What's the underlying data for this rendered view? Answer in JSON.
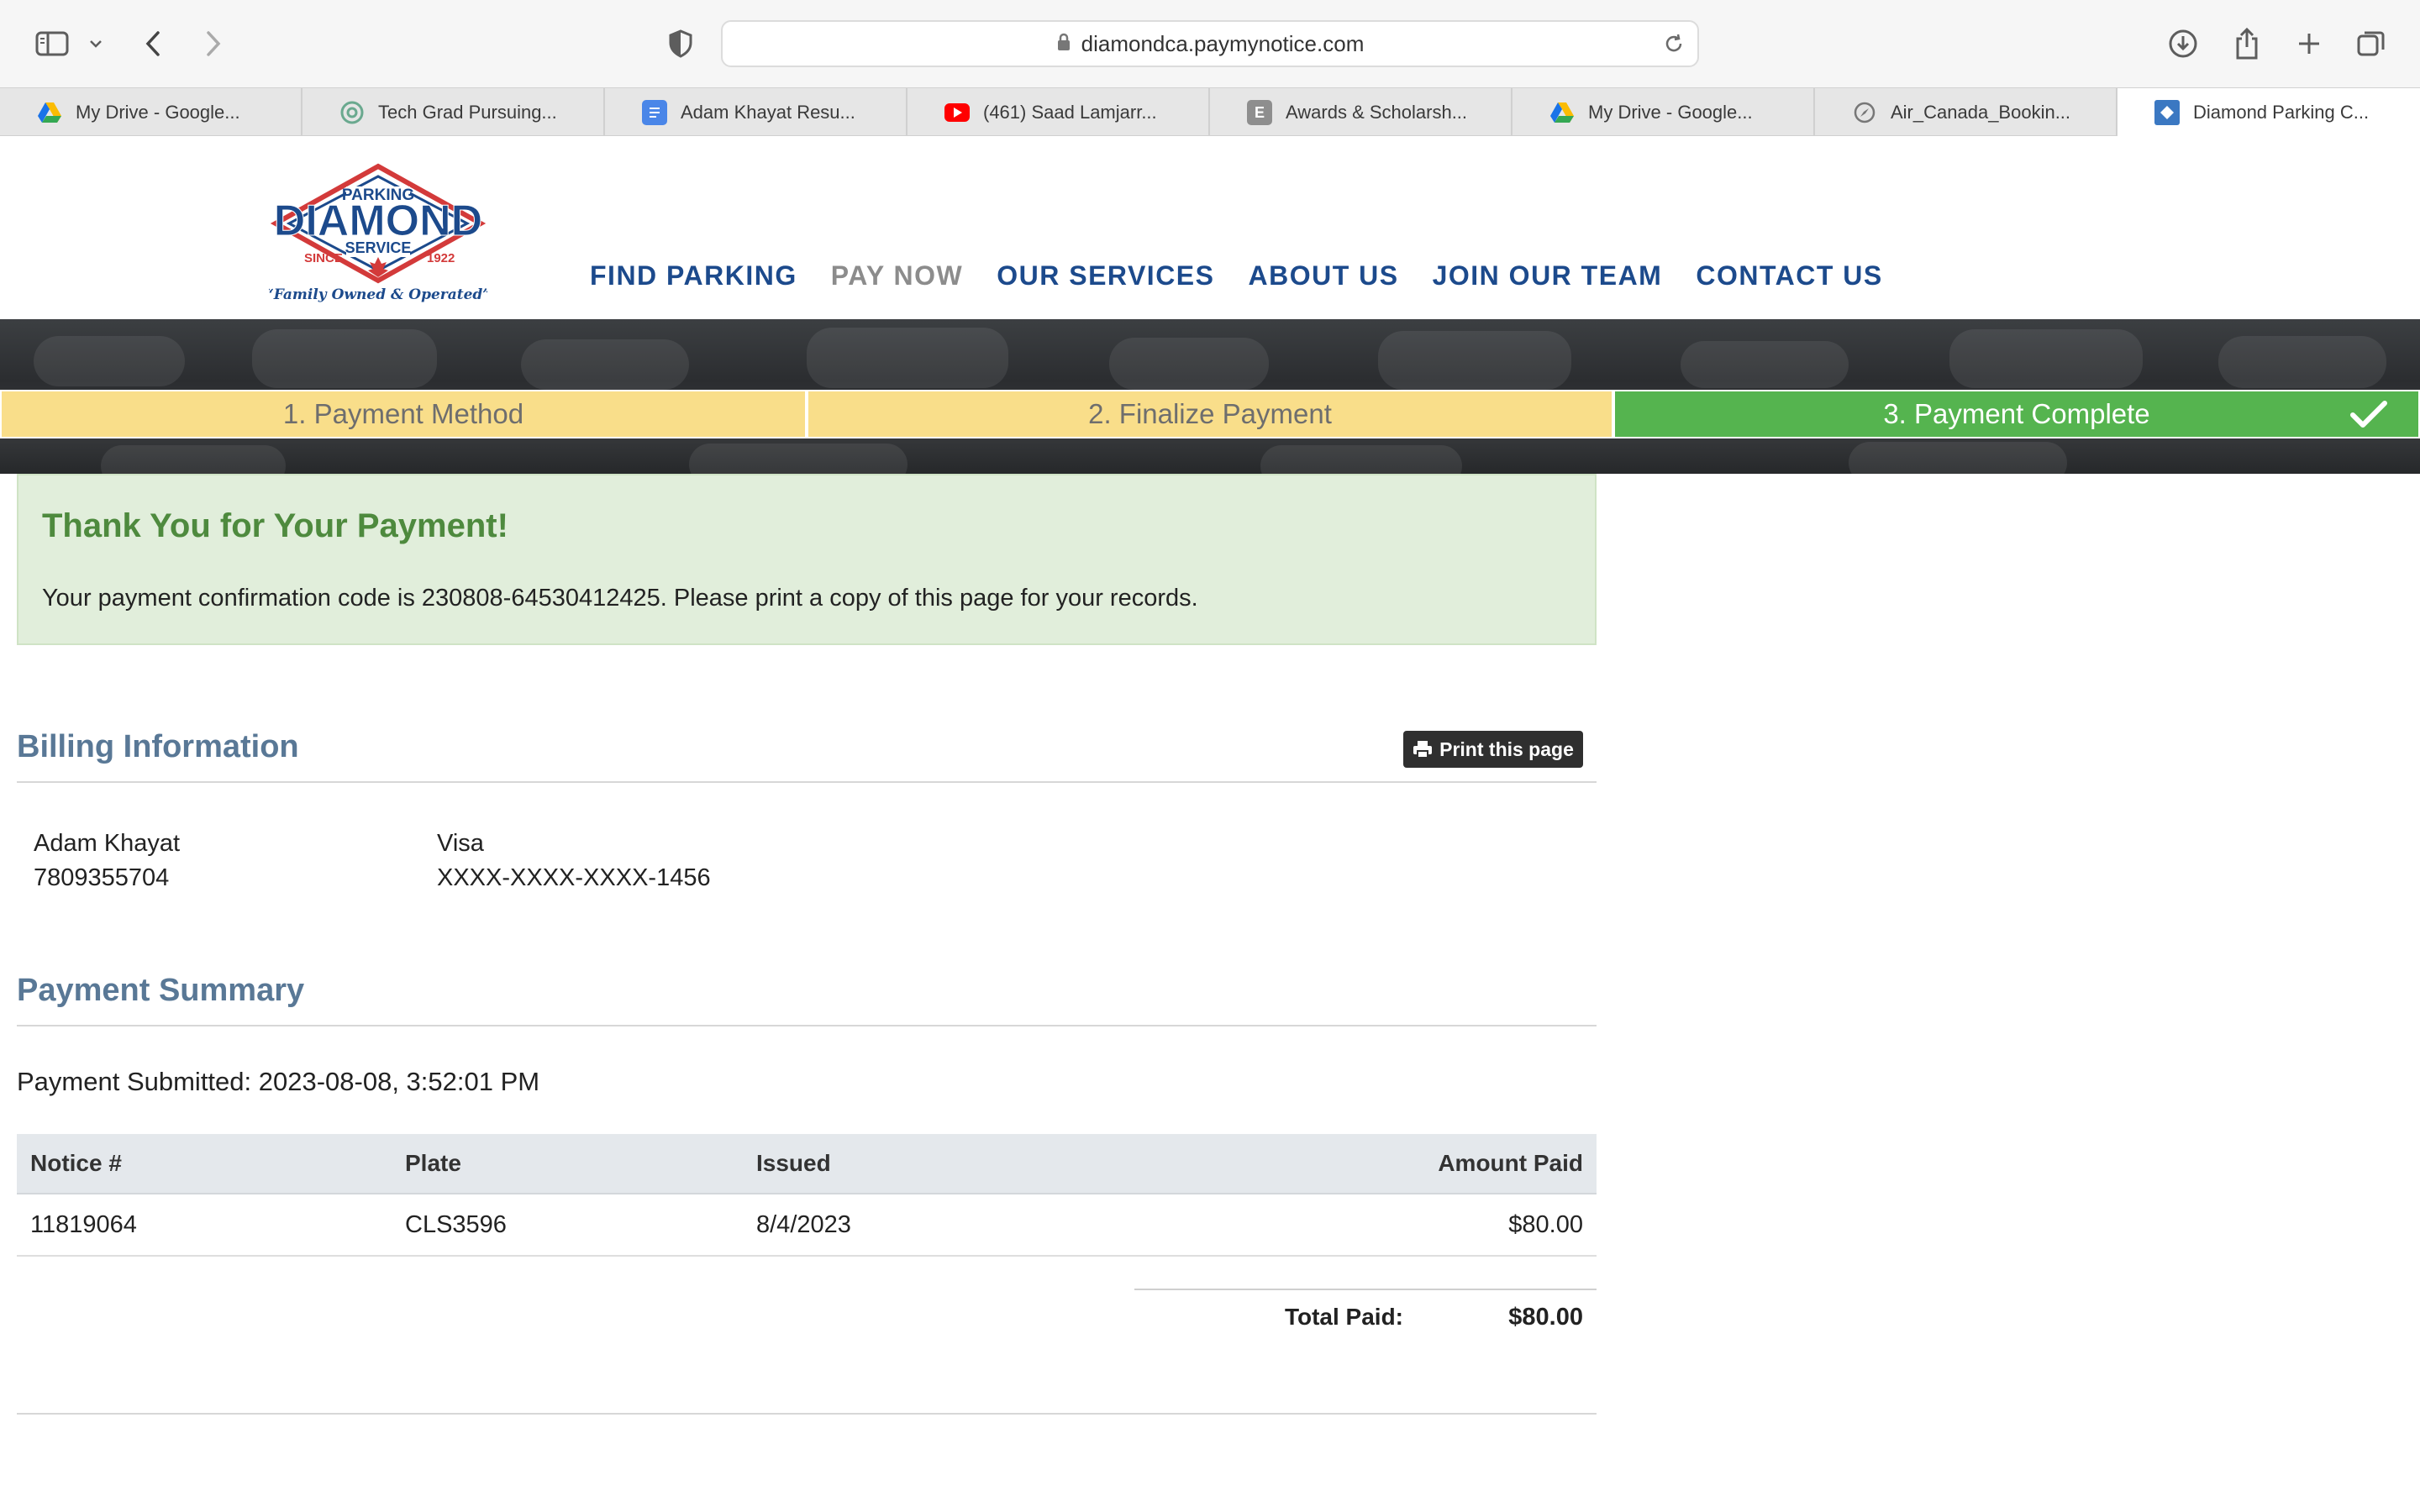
{
  "browser": {
    "url": "diamondca.paymynotice.com",
    "tabs": [
      {
        "label": "My Drive - Google...",
        "icon": "google-drive-icon"
      },
      {
        "label": "Tech Grad Pursuing...",
        "icon": "chatgpt-icon"
      },
      {
        "label": "Adam Khayat Resu...",
        "icon": "google-docs-icon"
      },
      {
        "label": "(461) Saad Lamjarr...",
        "icon": "youtube-icon"
      },
      {
        "label": "Awards & Scholarsh...",
        "icon": "e-letter-icon"
      },
      {
        "label": "My Drive - Google...",
        "icon": "google-drive-icon"
      },
      {
        "label": "Air_Canada_Bookin...",
        "icon": "compass-icon"
      },
      {
        "label": "Diamond Parking C...",
        "icon": "diamond-parking-icon"
      }
    ]
  },
  "site": {
    "logo": {
      "top": "PARKING",
      "main": "DIAMOND",
      "sub": "SERVICE",
      "since": "SINCE",
      "year": "1922",
      "tagline": "“Family Owned & Operated”"
    },
    "nav": [
      "FIND PARKING",
      "PAY NOW",
      "OUR SERVICES",
      "ABOUT US",
      "JOIN OUR TEAM",
      "CONTACT US"
    ],
    "current_nav": "PAY NOW",
    "steps": [
      {
        "label": "1. Payment Method",
        "state": "todo"
      },
      {
        "label": "2. Finalize Payment",
        "state": "todo"
      },
      {
        "label": "3. Payment Complete",
        "state": "done"
      }
    ],
    "colors": {
      "nav": "#1c4a8c",
      "step_todo": "#f9de8a",
      "step_done": "#55b44f",
      "alert_bg": "#e1eedb",
      "alert_title": "#4e8a3e",
      "section_title": "#597896"
    }
  },
  "confirmation": {
    "title": "Thank You for Your Payment!",
    "text": "Your payment confirmation code is 230808-64530412425. Please print a copy of this page for your records."
  },
  "billing": {
    "title": "Billing Information",
    "print_label": "Print this page",
    "name": "Adam Khayat",
    "phone": "7809355704",
    "card_type": "Visa",
    "card_number": "XXXX-XXXX-XXXX-1456"
  },
  "summary": {
    "title": "Payment Summary",
    "submitted": "Payment Submitted: 2023-08-08, 3:52:01 PM",
    "columns": [
      "Notice #",
      "Plate",
      "Issued",
      "Amount Paid"
    ],
    "rows": [
      [
        "11819064",
        "CLS3596",
        "8/4/2023",
        "$80.00"
      ]
    ],
    "total_label": "Total Paid:",
    "total_value": "$80.00"
  }
}
